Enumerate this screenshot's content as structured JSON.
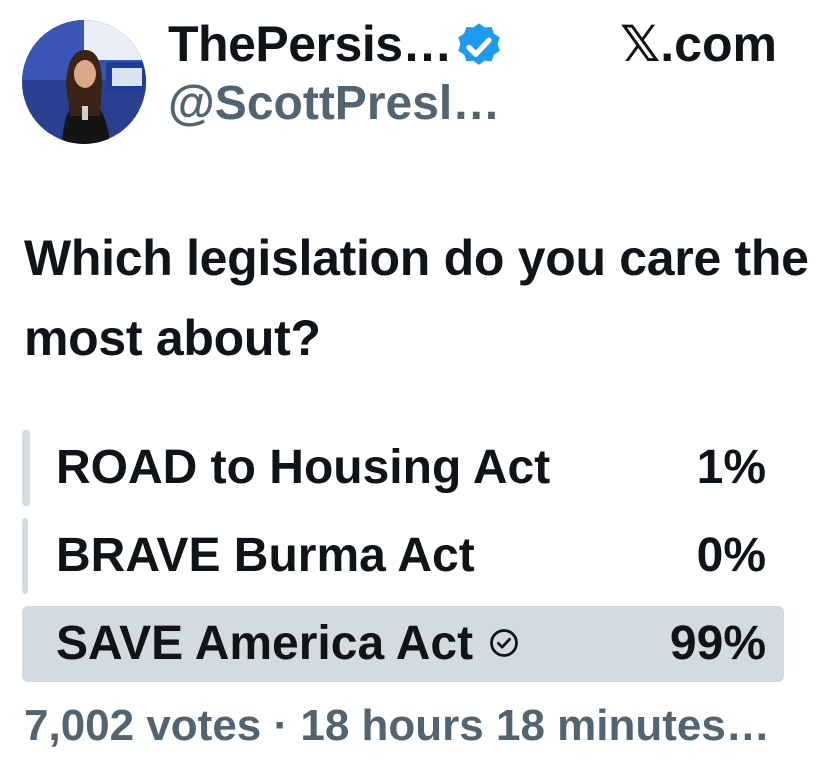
{
  "author": {
    "display_name": "ThePersis…",
    "handle": "@ScottPresl…",
    "verified": true,
    "avatar": "person-speaking-at-podium-avatar"
  },
  "platform": {
    "brand": "𝕏.com"
  },
  "poll": {
    "question": "Which legislation do you care the most about?",
    "options": [
      {
        "label": "ROAD to Housing Act",
        "percent_text": "1%",
        "percent": 1,
        "selected": false
      },
      {
        "label": "BRAVE Burma Act",
        "percent_text": "0%",
        "percent": 0,
        "selected": false
      },
      {
        "label": "SAVE America Act",
        "percent_text": "99%",
        "percent": 99,
        "selected": true
      }
    ],
    "meta": "7,002 votes · 18 hours 18 minutes…",
    "selected_icon": "check-circle-icon"
  },
  "colors": {
    "verified_blue": "#1d9bf0",
    "bar_gray": "#d3dbe0",
    "text_primary": "#0f1419",
    "text_secondary": "#536471"
  }
}
